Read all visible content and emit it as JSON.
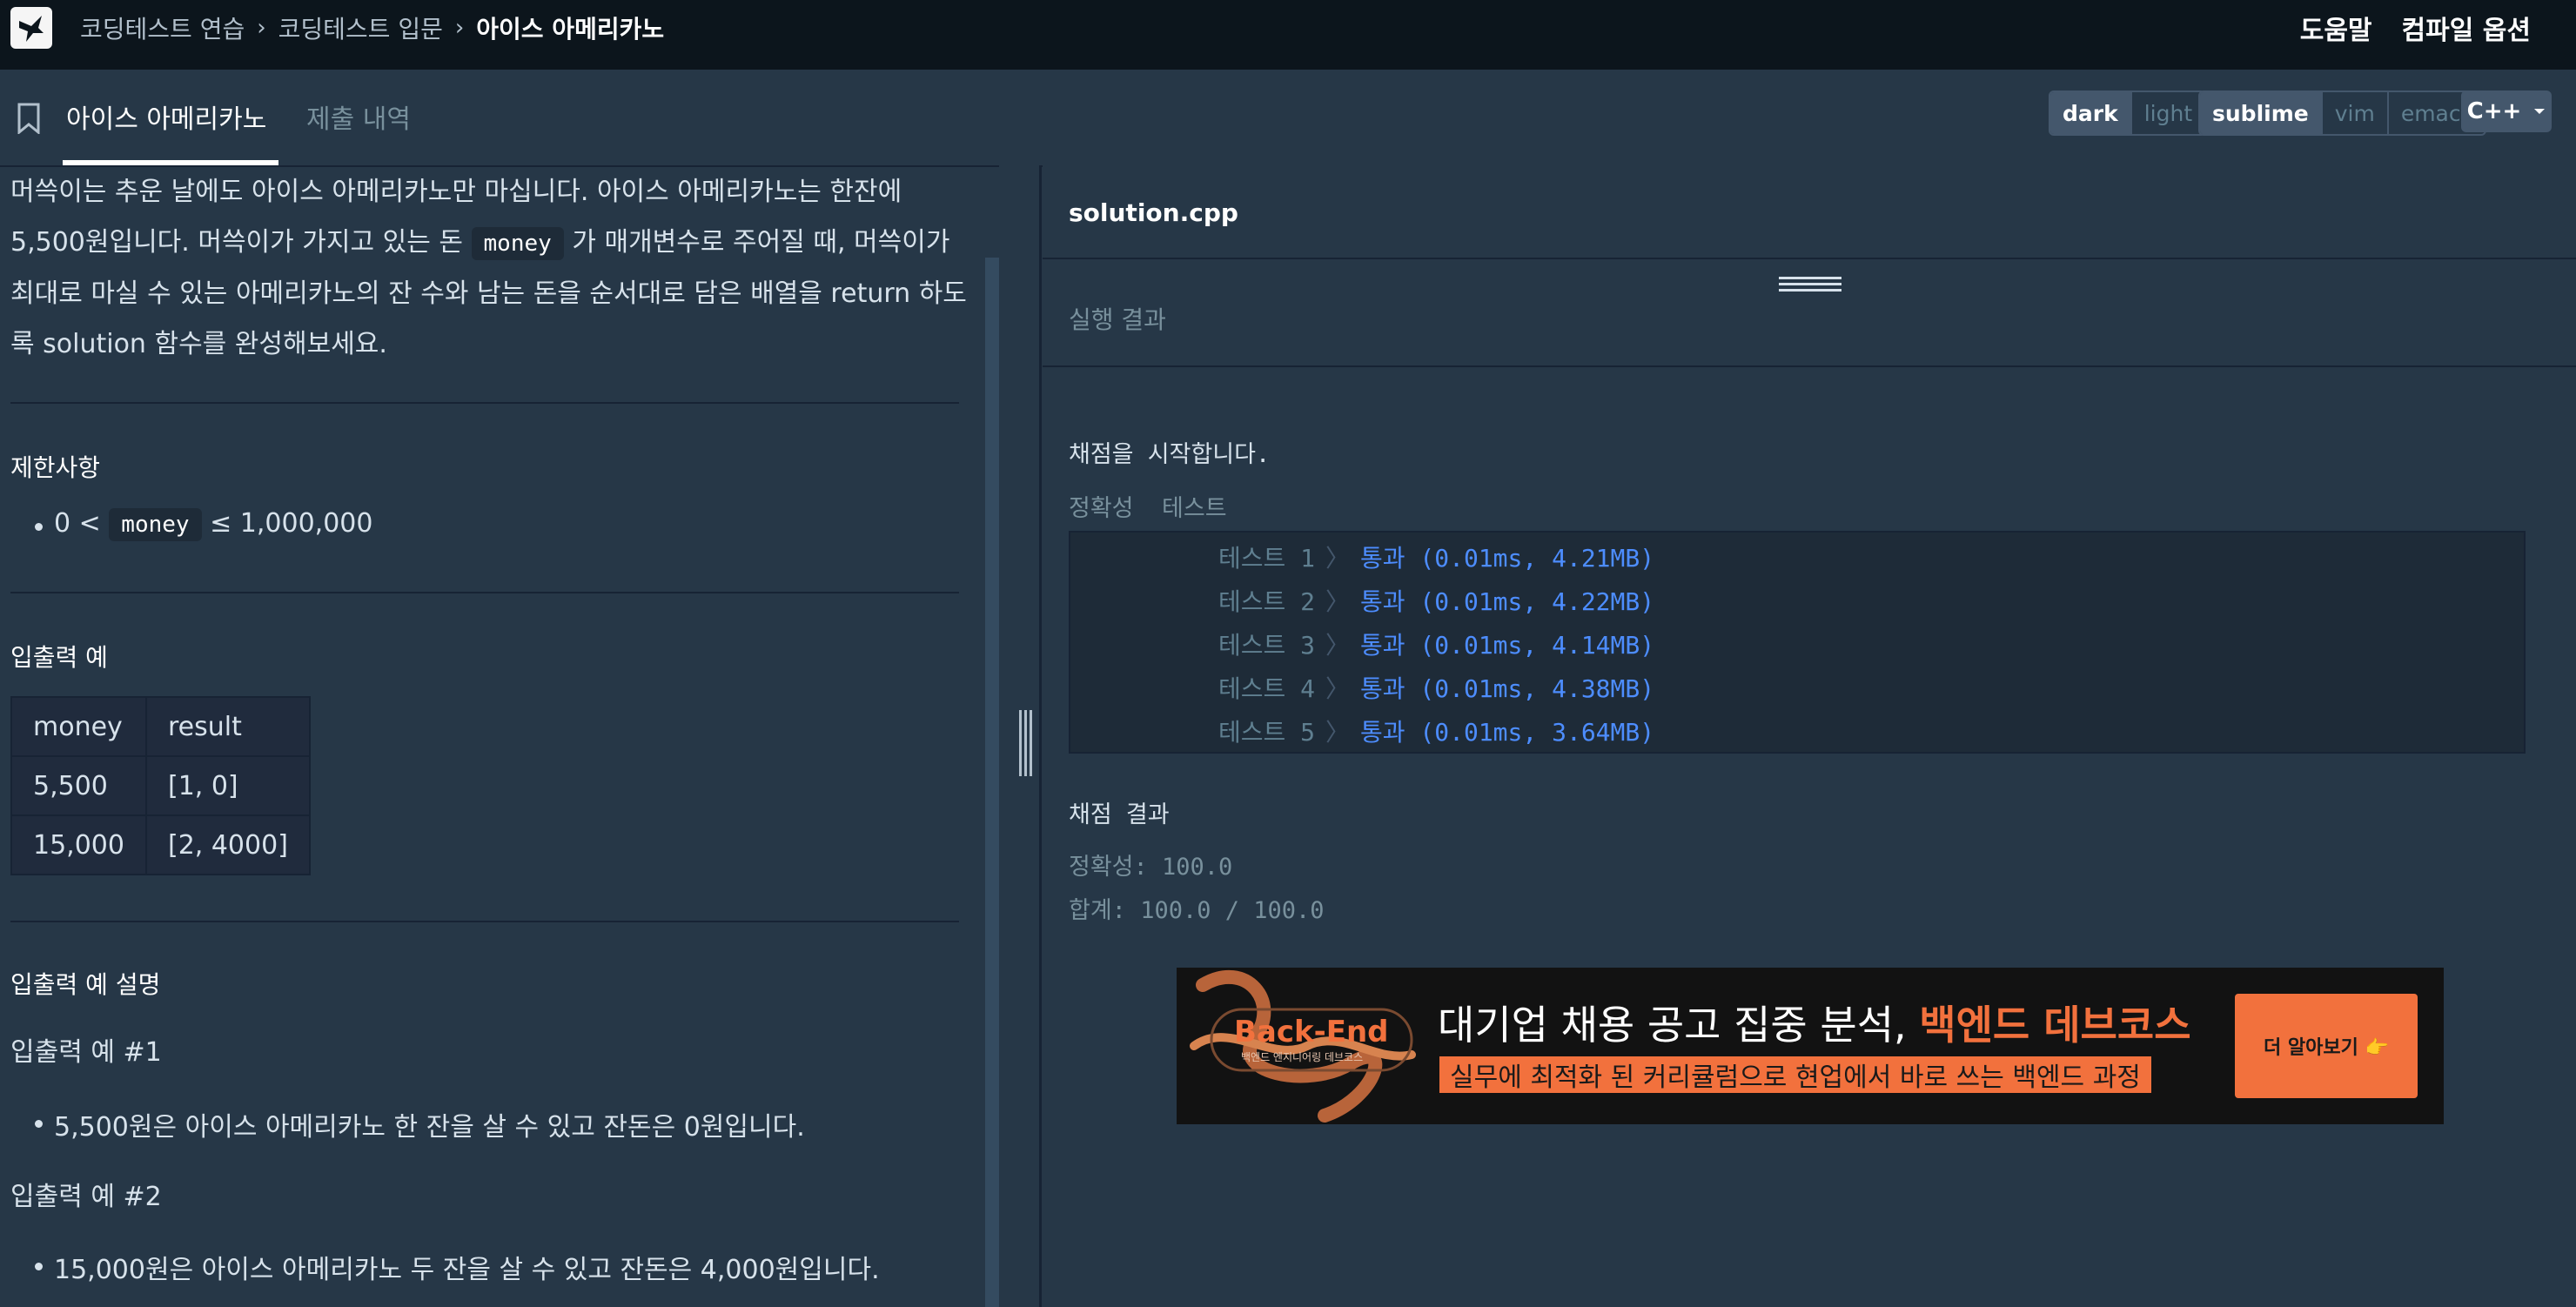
{
  "breadcrumb": [
    "코딩테스트 연습",
    "코딩테스트 입문",
    "아이스 아메리카노"
  ],
  "header": {
    "help": "도움말",
    "compile_options": "컴파일 옵션"
  },
  "tabs": {
    "problem": "아이스 아메리카노",
    "submissions": "제출 내역"
  },
  "theme": {
    "dark": "dark",
    "light": "light",
    "selected": "dark"
  },
  "keymap": {
    "sublime": "sublime",
    "vim": "vim",
    "emacs": "emacs",
    "selected": "sublime"
  },
  "language": "C++",
  "problem": {
    "desc_1": "머쓱이는 추운 날에도 아이스 아메리카노만 마십니다. 아이스 아메리카노는 한잔에 5,500원입니다. 머쓱이가 가지고 있는 돈 ",
    "desc_code": "money",
    "desc_2": " 가 매개변수로 주어질 때, 머쓱이가 최대로 마실 수 있는 아메리카노의 잔 수와 남는 돈을 순서대로 담은 배열을 return 하도록 solution 함수를 완성해보세요.",
    "constraints_title": "제한사항",
    "constraint_pre": "0 < ",
    "constraint_code": "money",
    "constraint_post": " ≤ 1,000,000",
    "examples_title": "입출력 예",
    "table_headers": [
      "money",
      "result"
    ],
    "table_rows": [
      [
        "5,500",
        "[1, 0]"
      ],
      [
        "15,000",
        "[2, 4000]"
      ]
    ],
    "explain_title": "입출력 예 설명",
    "ex1_title": "입출력 예 #1",
    "ex1_text": "5,500원은 아이스 아메리카노 한 잔을 살 수 있고 잔돈은 0원입니다.",
    "ex2_title": "입출력 예 #2",
    "ex2_text": "15,000원은 아이스 아메리카노 두 잔을 살 수 있고 잔돈은 4,000원입니다."
  },
  "editor": {
    "filename": "solution.cpp"
  },
  "output": {
    "title": "실행 결과",
    "start": "채점을 시작합니다.",
    "section_accuracy": "정확성  테스트",
    "tests": [
      {
        "label": "테스트 1",
        "result": "통과 (0.01ms, 4.21MB)"
      },
      {
        "label": "테스트 2",
        "result": "통과 (0.01ms, 4.22MB)"
      },
      {
        "label": "테스트 3",
        "result": "통과 (0.01ms, 4.14MB)"
      },
      {
        "label": "테스트 4",
        "result": "통과 (0.01ms, 4.38MB)"
      },
      {
        "label": "테스트 5",
        "result": "통과 (0.01ms, 3.64MB)"
      }
    ],
    "grading_title": "채점 결과",
    "accuracy": "정확성: 100.0",
    "total": "합계: 100.0 / 100.0"
  },
  "banner": {
    "logo_title": "Back-End",
    "logo_sub": "백엔드 엔지니어링 데브코스",
    "headline_pre": "대기업 채용 공고 집중 분석, ",
    "headline_em": "백엔드 데브코스",
    "subline": "실무에 최적화 된 커리큘럼으로 현업에서 바로 쓰는 백엔드 과정",
    "cta": "더 알아보기 👉"
  },
  "colors": {
    "bg": "#263747",
    "topbar": "#0c151c",
    "pass": "#4d8dff",
    "accent": "#f2713d"
  }
}
